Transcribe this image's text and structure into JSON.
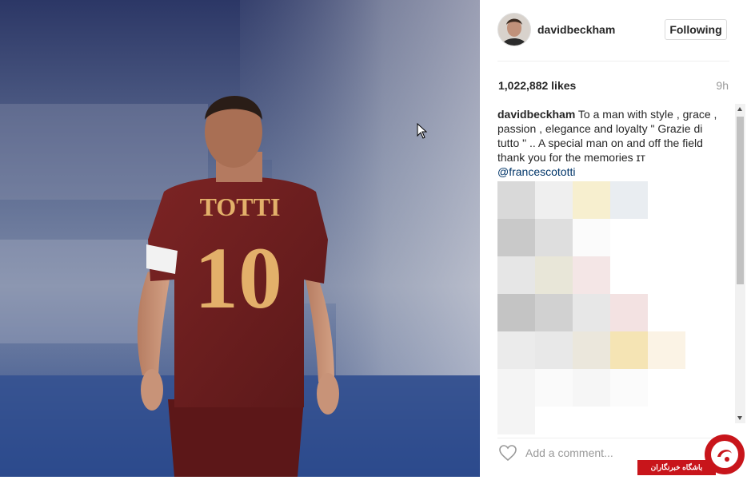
{
  "post": {
    "username": "davidbeckham",
    "follow_label": "Following",
    "likes": "1,022,882 likes",
    "time": "9h",
    "caption_user": "davidbeckham",
    "caption_text": "To a man with style , grace , passion , elegance and loyalty \" Grazie di tutto \" .. A special man on and off the field thank you for the memories ɪᴛ",
    "caption_mention": "@francescototti",
    "comment_placeholder": "Add a comment..."
  },
  "photo": {
    "jersey_name": "TOTTI",
    "jersey_number": "10"
  },
  "watermark": {
    "text": "باشگاه خبرنگاران"
  },
  "colors": {
    "jersey": "#6e1f20",
    "jersey_text": "#e3b06a",
    "mention": "#003569",
    "watermark_red": "#c8151b"
  },
  "icons": {
    "like": "heart-icon",
    "pointer": "mouse-cursor-icon"
  }
}
